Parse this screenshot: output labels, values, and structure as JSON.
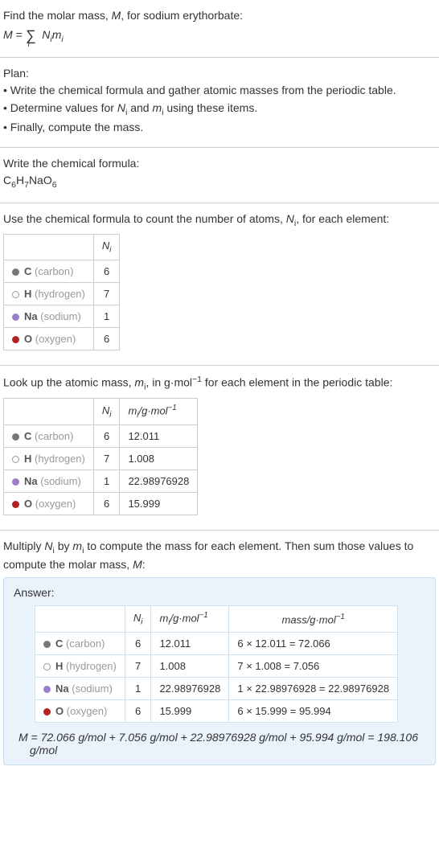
{
  "intro": {
    "l1": "Find the molar mass, ",
    "M": "M",
    "l2": ", for sodium erythorbate:",
    "eqL": "M = ",
    "eqSum": "∑",
    "eqIdx": "i",
    "eqR": " N",
    "eqR2": "m",
    "eqR3": "i"
  },
  "plan": {
    "title": "Plan:",
    "b1": "• Write the chemical formula and gather atomic masses from the periodic table.",
    "b2_a": "• Determine values for ",
    "b2_N": "N",
    "b2_b": " and ",
    "b2_m": "m",
    "b2_c": " using these items.",
    "b3": "• Finally, compute the mass."
  },
  "chemformula": {
    "title": "Write the chemical formula:",
    "c": "C",
    "c6": "6",
    "h": "H",
    "h7": "7",
    "na": "Na",
    "o": "O",
    "o6": "6"
  },
  "count": {
    "t1": "Use the chemical formula to count the number of atoms, ",
    "N": "N",
    "t2": ", for each element:",
    "hdr_N": "N",
    "hdr_i": "i",
    "elems": [
      {
        "dot": "dot-c",
        "sym": "C",
        "name": " (carbon)",
        "n": "6"
      },
      {
        "dot": "dot-h",
        "sym": "H",
        "name": " (hydrogen)",
        "n": "7"
      },
      {
        "dot": "dot-na",
        "sym": "Na",
        "name": " (sodium)",
        "n": "1"
      },
      {
        "dot": "dot-o",
        "sym": "O",
        "name": " (oxygen)",
        "n": "6"
      }
    ]
  },
  "lookup": {
    "t1": "Look up the atomic mass, ",
    "m": "m",
    "t2": ", in g·mol",
    "t3": " for each element in the periodic table:",
    "hdr_N": "N",
    "hdr_i": "i",
    "hdr_m": "m",
    "hdr_unit_a": "/g·mol",
    "hdr_unit_exp": "−1",
    "rows": [
      {
        "dot": "dot-c",
        "sym": "C",
        "name": " (carbon)",
        "n": "6",
        "m": "12.011"
      },
      {
        "dot": "dot-h",
        "sym": "H",
        "name": " (hydrogen)",
        "n": "7",
        "m": "1.008"
      },
      {
        "dot": "dot-na",
        "sym": "Na",
        "name": " (sodium)",
        "n": "1",
        "m": "22.98976928"
      },
      {
        "dot": "dot-o",
        "sym": "O",
        "name": " (oxygen)",
        "n": "6",
        "m": "15.999"
      }
    ]
  },
  "multiply": {
    "t1": "Multiply ",
    "N": "N",
    "t2": " by ",
    "m": "m",
    "t3": " to compute the mass for each element. Then sum those values to compute the molar mass, ",
    "M": "M",
    "t4": ":"
  },
  "answer": {
    "label": "Answer:",
    "hdr_N": "N",
    "hdr_i": "i",
    "hdr_m": "m",
    "hdr_munit": "/g·mol",
    "hdr_munit_exp": "−1",
    "hdr_mass": "mass/g·mol",
    "hdr_mass_exp": "−1",
    "rows": [
      {
        "dot": "dot-c",
        "sym": "C",
        "name": " (carbon)",
        "n": "6",
        "m": "12.011",
        "calc": "6 × 12.011 = 72.066"
      },
      {
        "dot": "dot-h",
        "sym": "H",
        "name": " (hydrogen)",
        "n": "7",
        "m": "1.008",
        "calc": "7 × 1.008 = 7.056"
      },
      {
        "dot": "dot-na",
        "sym": "Na",
        "name": " (sodium)",
        "n": "1",
        "m": "22.98976928",
        "calc": "1 × 22.98976928 = 22.98976928"
      },
      {
        "dot": "dot-o",
        "sym": "O",
        "name": " (oxygen)",
        "n": "6",
        "m": "15.999",
        "calc": "6 × 15.999 = 95.994"
      }
    ],
    "final_a": "M",
    "final_b": " = 72.066 g/mol + 7.056 g/mol + 22.98976928 g/mol + 95.994 g/mol = 198.106 g/mol"
  }
}
